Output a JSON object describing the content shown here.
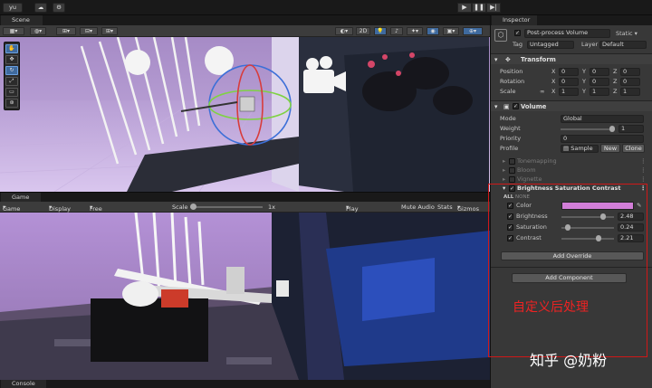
{
  "topbar": {
    "account": "yu",
    "play_icon": "▶",
    "pause_icon": "❚❚",
    "step_icon": "▶|"
  },
  "scene": {
    "tab_label": "Scene",
    "mode_2d": "2D",
    "tools": [
      "hand-icon",
      "move-icon",
      "rotate-icon",
      "scale-icon",
      "rect-icon",
      "transform-icon"
    ]
  },
  "game": {
    "tab_label": "Game",
    "display_mode": "Game",
    "display": "Display 1",
    "aspect": "Free Aspect",
    "scale_label": "Scale",
    "scale_value": "1x",
    "play_focused": "Play Focused",
    "mute_audio": "Mute Audio",
    "stats": "Stats",
    "gizmos": "Gizmos"
  },
  "console": {
    "tab_label": "Console"
  },
  "inspector": {
    "tab_label": "Inspector",
    "object_name": "Post-process Volume",
    "static_label": "Static",
    "tag_label": "Tag",
    "tag_value": "Untagged",
    "layer_label": "Layer",
    "layer_value": "Default",
    "transform": {
      "title": "Transform",
      "rows": [
        {
          "label": "Position",
          "x": "0",
          "y": "0",
          "z": "0"
        },
        {
          "label": "Rotation",
          "x": "0",
          "y": "0",
          "z": "0"
        },
        {
          "label": "Scale",
          "x": "1",
          "y": "1",
          "z": "1"
        }
      ]
    },
    "volume": {
      "title": "Volume",
      "mode_label": "Mode",
      "mode_value": "Global",
      "weight_label": "Weight",
      "weight_value": "1",
      "weight": 1.0,
      "priority_label": "Priority",
      "priority_value": "0",
      "profile_label": "Profile",
      "profile_value": "Sample",
      "new_label": "New",
      "clone_label": "Clone"
    },
    "effects": [
      "Tonemapping",
      "Bloom",
      "Vignette"
    ],
    "bsc": {
      "title": "Brightness Saturation Contrast",
      "all_label": "ALL",
      "none_label": "NONE",
      "color_label": "Color",
      "color_hex": "#d27ed8",
      "brightness_label": "Brightness",
      "brightness_value": "2.48",
      "brightness": 0.83,
      "saturation_label": "Saturation",
      "saturation_value": "0.24",
      "saturation": 0.08,
      "contrast_label": "Contrast",
      "contrast_value": "2.21",
      "contrast": 0.74
    },
    "add_override_label": "Add Override",
    "add_component_label": "Add Component"
  },
  "annotation": {
    "text": "自定义后处理",
    "color": "#ee2222"
  },
  "watermark": {
    "text": "知乎 @奶粉"
  }
}
